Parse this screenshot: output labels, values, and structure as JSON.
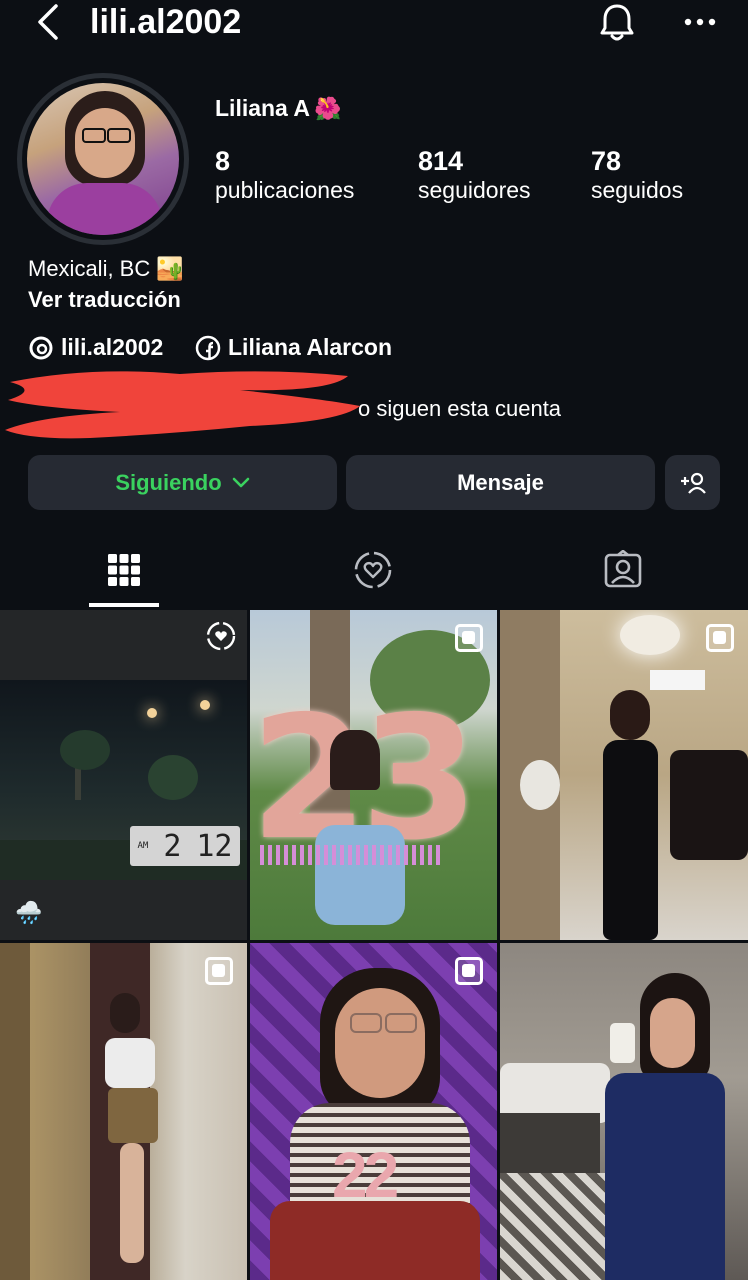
{
  "header": {
    "username": "lili.al2002",
    "back_icon": "chevron-left-icon",
    "bell_icon": "bell-icon",
    "more_icon": "more-horizontal-icon"
  },
  "profile": {
    "name": "Liliana A",
    "name_emoji": "🌺",
    "stats": [
      {
        "value": "8",
        "label": "publicaciones"
      },
      {
        "value": "814",
        "label": "seguidores"
      },
      {
        "value": "78",
        "label": "seguidos"
      }
    ],
    "location": "Mexicali, BC",
    "location_emoji": "🏜️",
    "translate": "Ver traducción",
    "threads_handle": "lili.al2002",
    "facebook_name": "Liliana Alarcon",
    "followed_by_text": "o siguen esta cuenta"
  },
  "actions": {
    "following": "Siguiendo",
    "message": "Mensaje",
    "add_user_icon": "add-person-icon"
  },
  "colors": {
    "following_green": "#3ad25f",
    "background": "#0c0f14",
    "button_bg": "#262a33",
    "redaction": "#f0443b"
  },
  "tabs": [
    {
      "name": "grid",
      "icon": "grid-icon",
      "active": true
    },
    {
      "name": "reels-liked",
      "icon": "heart-circle-icon",
      "active": false
    },
    {
      "name": "tagged",
      "icon": "person-tag-icon",
      "active": false
    }
  ],
  "posts": {
    "clock_time_a": "2",
    "clock_time_b": "12",
    "clock_am": "AM",
    "balloon_number": "23",
    "candle_number": "22",
    "weather_emoji": "🌧️"
  }
}
